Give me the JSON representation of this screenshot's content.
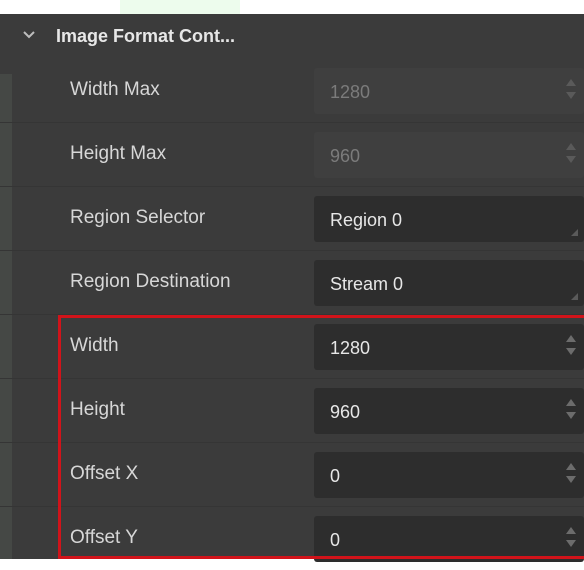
{
  "panel": {
    "title": "Image Format Cont...",
    "collapse_icon": "chevron-down-icon"
  },
  "params": [
    {
      "label": "Width Max",
      "value": "1280",
      "type": "spinbox",
      "enabled": false
    },
    {
      "label": "Height Max",
      "value": "960",
      "type": "spinbox",
      "enabled": false
    },
    {
      "label": "Region Selector",
      "value": "Region 0",
      "type": "combobox",
      "enabled": true
    },
    {
      "label": "Region Destination",
      "value": "Stream 0",
      "type": "combobox",
      "enabled": true
    },
    {
      "label": "Width",
      "value": "1280",
      "type": "spinbox",
      "enabled": true
    },
    {
      "label": "Height",
      "value": "960",
      "type": "spinbox",
      "enabled": true
    },
    {
      "label": "Offset X",
      "value": "0",
      "type": "spinbox",
      "enabled": true
    },
    {
      "label": "Offset Y",
      "value": "0",
      "type": "spinbox",
      "enabled": true
    }
  ],
  "colors": {
    "panel_bg": "#3b3b3b",
    "field_bg": "#2d2d2d",
    "field_disabled_bg": "#3f3f3f",
    "highlight": "#d1131a"
  }
}
